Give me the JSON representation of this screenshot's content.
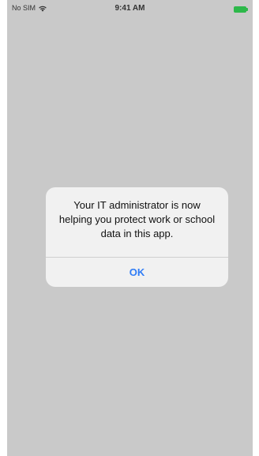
{
  "status_bar": {
    "carrier": "No SIM",
    "time": "9:41 AM",
    "wifi_icon": "wifi-icon",
    "battery_icon": "battery-icon",
    "battery_color": "#2db84a"
  },
  "alert": {
    "message": "Your IT administrator is now helping you protect work or school data in this app.",
    "ok_label": "OK",
    "button_color": "#2f7cf6"
  },
  "colors": {
    "background": "#c9c9c9",
    "alert_background": "#f1f1f1"
  }
}
